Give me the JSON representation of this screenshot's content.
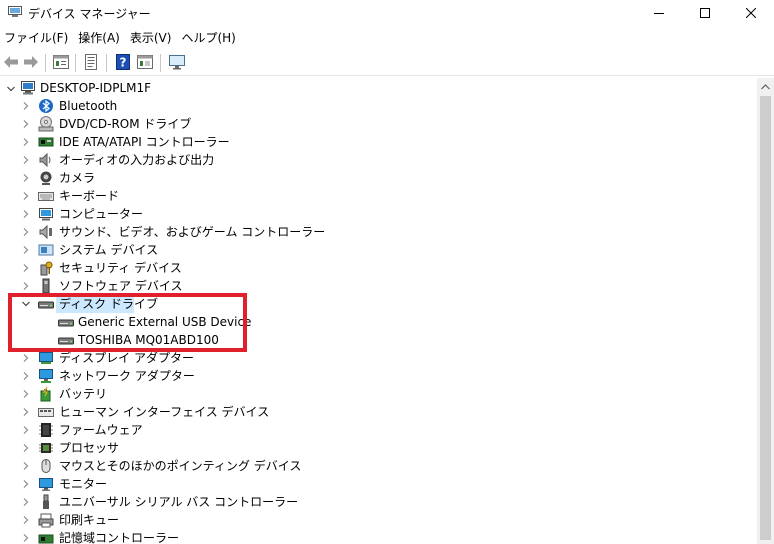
{
  "window": {
    "title": "デバイス マネージャー",
    "icon": "device-manager-icon"
  },
  "menu": [
    "ファイル(F)",
    "操作(A)",
    "表示(V)",
    "ヘルプ(H)"
  ],
  "toolbar": [
    "back-arrow-icon",
    "forward-arrow-icon",
    "properties-icon",
    "update-icon",
    "help-icon",
    "scan-icon",
    "monitor-icon"
  ],
  "tree": {
    "root": "DESKTOP-IDPLM1F",
    "categories": [
      {
        "label": "Bluetooth",
        "icon": "bluetooth-icon"
      },
      {
        "label": "DVD/CD-ROM ドライブ",
        "icon": "dvd-drive-icon"
      },
      {
        "label": "IDE ATA/ATAPI コントローラー",
        "icon": "ide-controller-icon"
      },
      {
        "label": "オーディオの入力および出力",
        "icon": "audio-icon"
      },
      {
        "label": "カメラ",
        "icon": "camera-icon"
      },
      {
        "label": "キーボード",
        "icon": "keyboard-icon"
      },
      {
        "label": "コンピューター",
        "icon": "computer-icon"
      },
      {
        "label": "サウンド、ビデオ、およびゲーム コントローラー",
        "icon": "sound-icon"
      },
      {
        "label": "システム デバイス",
        "icon": "system-device-icon"
      },
      {
        "label": "セキュリティ デバイス",
        "icon": "security-device-icon"
      },
      {
        "label": "ソフトウェア デバイス",
        "icon": "software-device-icon"
      },
      {
        "label": "ディスク ドライブ",
        "icon": "disk-drive-icon",
        "expanded": true,
        "selected": true,
        "children": [
          "Generic External USB Device",
          "TOSHIBA MQ01ABD100"
        ]
      },
      {
        "label": "ディスプレイ アダプター",
        "icon": "display-adapter-icon"
      },
      {
        "label": "ネットワーク アダプター",
        "icon": "network-adapter-icon"
      },
      {
        "label": "バッテリ",
        "icon": "battery-icon"
      },
      {
        "label": "ヒューマン インターフェイス デバイス",
        "icon": "hid-icon"
      },
      {
        "label": "ファームウェア",
        "icon": "firmware-icon"
      },
      {
        "label": "プロセッサ",
        "icon": "processor-icon"
      },
      {
        "label": "マウスとそのほかのポインティング デバイス",
        "icon": "mouse-icon"
      },
      {
        "label": "モニター",
        "icon": "monitor-icon"
      },
      {
        "label": "ユニバーサル シリアル バス コントローラー",
        "icon": "usb-icon"
      },
      {
        "label": "印刷キュー",
        "icon": "print-queue-icon"
      },
      {
        "label": "記憶域コントローラー",
        "icon": "storage-controller-icon"
      }
    ]
  },
  "colors": {
    "selection": "#cce8ff",
    "highlight_border": "#e0202a"
  }
}
